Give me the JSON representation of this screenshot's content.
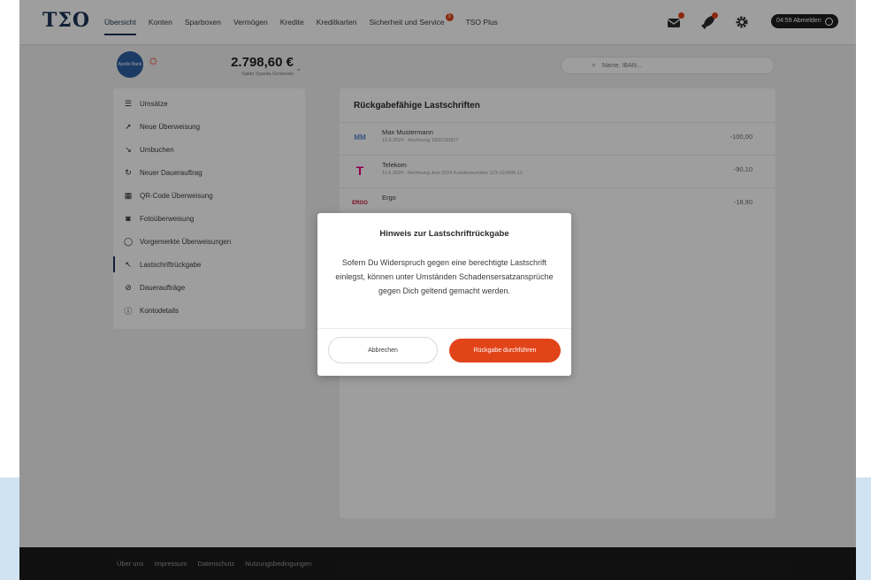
{
  "header": {
    "logo": "TΣO",
    "nav": [
      {
        "label": "Übersicht",
        "active": true
      },
      {
        "label": "Konten"
      },
      {
        "label": "Sparboxen"
      },
      {
        "label": "Vermögen"
      },
      {
        "label": "Kredite"
      },
      {
        "label": "Kreditkarten"
      },
      {
        "label": "Sicherheit und Service",
        "badge": "3"
      },
      {
        "label": "TSO Plus"
      }
    ],
    "logout_label": "04:59 Abmelden",
    "icons": [
      "mail-icon",
      "rocket-icon",
      "gear-icon",
      "power-icon"
    ]
  },
  "account": {
    "logo_text": "Apollo Bank",
    "balance": "2.798,60 €",
    "balance_subtitle": "Saldo Sparda Girokonto"
  },
  "search": {
    "placeholder": "Name, IBAN..."
  },
  "sidebar": {
    "items": [
      {
        "label": "Umsätze",
        "icon": "list-icon"
      },
      {
        "label": "Neue Überweisung",
        "icon": "send-icon"
      },
      {
        "label": "Umbuchen",
        "icon": "transfer-icon"
      },
      {
        "label": "Neuer Dauerauftrag",
        "icon": "repeat-icon"
      },
      {
        "label": "QR-Code Überweisung",
        "icon": "qr-icon"
      },
      {
        "label": "Fotoüberweisung",
        "icon": "camera-icon"
      },
      {
        "label": "Vorgemerkte Überweisungen",
        "icon": "clock-icon"
      },
      {
        "label": "Lastschriftrückgabe",
        "icon": "return-icon",
        "active": true
      },
      {
        "label": "Daueraufträge",
        "icon": "calendar-icon"
      },
      {
        "label": "Kontodetails",
        "icon": "info-icon"
      }
    ]
  },
  "main": {
    "title": "Rückgabefähige Lastschriften",
    "transactions": [
      {
        "logo": "MM",
        "logo_color": "#5b8ad6",
        "name": "Max Mustermann",
        "details": "13.6.2024 · Rechnung 1832230817",
        "amount": "-100,00"
      },
      {
        "logo": "T",
        "logo_color": "#e20074",
        "name": "Telekom",
        "details": "11.6.2024 · Rechnung Juni 2024 Kundennummer 123-123495-12",
        "amount": "-90,10"
      },
      {
        "logo": "ERGO",
        "logo_color": "#c8102e",
        "name": "Ergo",
        "details": "",
        "amount": "-18,90"
      }
    ]
  },
  "modal": {
    "title": "Hinweis zur Lastschriftrückgabe",
    "text": "Sofern Du Widerspruch gegen eine berechtigte Lastschrift einlegst, können unter Umständen Schadensersatzansprüche gegen Dich geltend gemacht werden.",
    "cancel_label": "Abbrechen",
    "confirm_label": "Rückgabe durchführen"
  },
  "footer": {
    "links": [
      "Über uns",
      "Impressum",
      "Datenschutz",
      "Nutzungsbedingungen"
    ]
  },
  "colors": {
    "brand": "#1c3557",
    "accent": "#e2441a",
    "footer": "#1b1b1b"
  }
}
